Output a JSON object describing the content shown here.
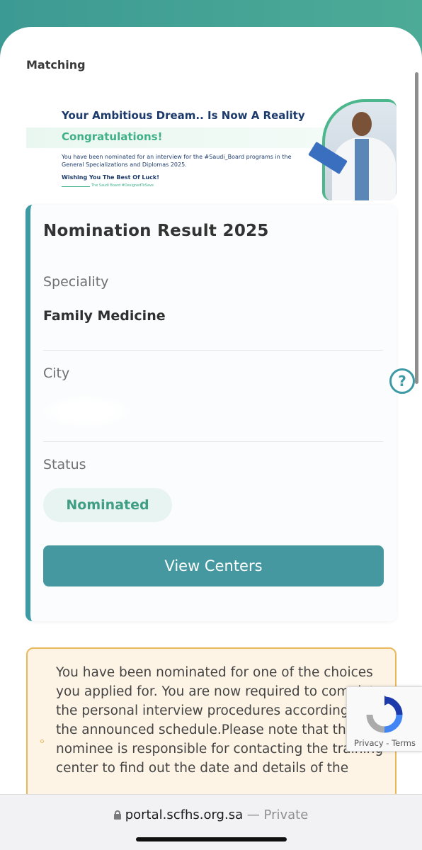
{
  "page": {
    "title": "Matching"
  },
  "banner": {
    "headline": "Your Ambitious Dream.. Is Now A Reality",
    "congrats": "Congratulations!",
    "body": "You have been nominated for an interview for the #Saudi_Board programs in the General Specializations and Diplomas 2025.",
    "wish": "Wishing You The Best Of Luck!",
    "tagline": "The Saudi Board #DesignedToSave"
  },
  "card": {
    "title": "Nomination Result 2025",
    "speciality_label": "Speciality",
    "speciality_value": "Family Medicine",
    "city_label": "City",
    "status_label": "Status",
    "status_value": "Nominated",
    "view_centers_label": "View Centers"
  },
  "notice": {
    "text": "You have been nominated for one of the choices you applied for. You are now required to complete the personal interview procedures according to the announced schedule.Please note that the nominee is responsible for contacting the training center to find out the date and details of the"
  },
  "recaptcha": {
    "privacy": "Privacy",
    "separator": " - ",
    "terms": "Terms"
  },
  "browser": {
    "domain": "portal.scfhs.org.sa",
    "suffix": " — Private"
  },
  "icons": {
    "help": "help-question-icon",
    "lock": "lock-icon"
  },
  "colors": {
    "accent": "#3d9aa4",
    "status": "#3f9e84",
    "notice_border": "#e9b85b"
  }
}
